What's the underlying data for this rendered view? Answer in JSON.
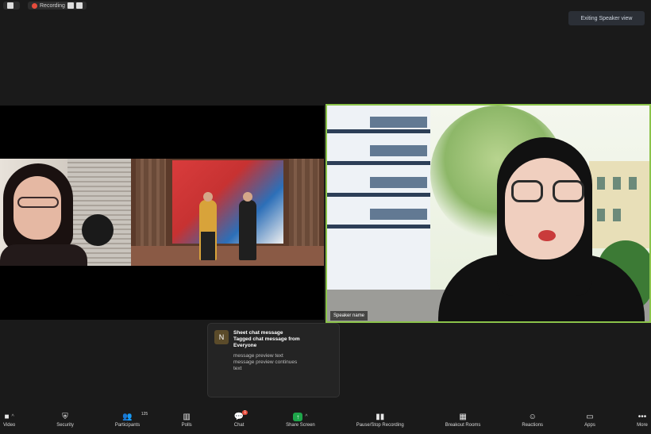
{
  "window": {
    "left_pill_label": "",
    "recording_label": "Recording",
    "view_button_label": "Exiting Speaker view"
  },
  "participants": {
    "left_name_letter": "",
    "right_name_label": "Speaker name"
  },
  "chat_popup": {
    "avatar_letter": "N",
    "title_line1": "Sheet chat message",
    "title_line2": "Tagged chat message from",
    "title_line3": "Everyone",
    "body_line1": "message preview text",
    "body_line2": "message preview continues",
    "body_line3": "text"
  },
  "toolbar": {
    "video_label": "Video",
    "security_label": "Security",
    "participants_label": "Participants",
    "participants_count": "125",
    "polls_label": "Polls",
    "chat_label": "Chat",
    "chat_badge": "1",
    "share_label": "Share Screen",
    "record_label": "Pause/Stop Recording",
    "breakout_label": "Breakout Rooms",
    "reactions_label": "Reactions",
    "apps_label": "Apps",
    "more_label": "More"
  },
  "colors": {
    "active_speaker_border": "#8bc34a",
    "share_green": "#1ea54a",
    "badge_red": "#e74c3c"
  },
  "icons": {
    "video": "video-camera-icon",
    "security": "shield-icon",
    "participants": "people-icon",
    "polls": "bar-chart-icon",
    "chat": "chat-bubble-icon",
    "share": "share-screen-icon",
    "record": "record-icon",
    "breakout": "grid-icon",
    "reactions": "smile-icon",
    "apps": "apps-icon",
    "more": "more-dots-icon"
  }
}
